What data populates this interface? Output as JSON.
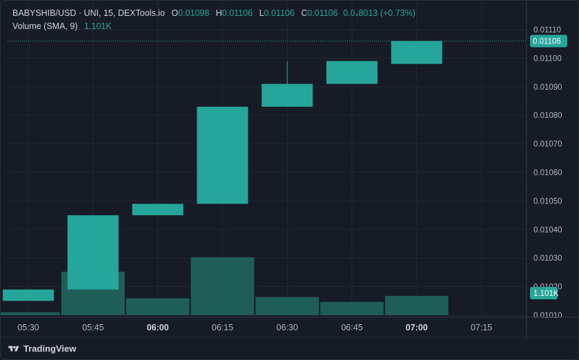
{
  "legend": {
    "symbol": "BABYSHIB/USD · UNI, 15, DEXTools.io",
    "o_label": "O",
    "o_value": "0.01098",
    "h_label": "H",
    "h_value": "0.01106",
    "l_label": "L",
    "l_value": "0.01106",
    "c_label": "C",
    "c_value": "0.01106",
    "change": "0.0₄8013 (+0.73%)",
    "volume_label": "Volume (SMA, 9)",
    "volume_value": "1.101K"
  },
  "brand": "TradingView",
  "colors": {
    "background": "#171b26",
    "grid": "#242833",
    "up": "#26a69a",
    "volume": "#1f5e58",
    "text": "#b2b5be"
  },
  "chart_data": {
    "type": "candlestick",
    "x_ticks": [
      {
        "label": "05:30",
        "bold": false
      },
      {
        "label": "05:45",
        "bold": false
      },
      {
        "label": "06:00",
        "bold": true
      },
      {
        "label": "06:15",
        "bold": false
      },
      {
        "label": "06:30",
        "bold": false
      },
      {
        "label": "06:45",
        "bold": false
      },
      {
        "label": "07:00",
        "bold": true
      },
      {
        "label": "07:15",
        "bold": false
      }
    ],
    "y_ticks": [
      "0.01110",
      "0.01100",
      "0.01090",
      "0.01080",
      "0.01070",
      "0.01060",
      "0.01050",
      "0.01040",
      "0.01030",
      "0.01020",
      "0.01010"
    ],
    "y_range": [
      0.0101,
      0.0111
    ],
    "last_price_label": "0.01106",
    "volume_label_tag": "1.101K",
    "candles": [
      {
        "time": "05:30",
        "open": 0.01015,
        "high": 0.01019,
        "low": 0.01015,
        "close": 0.01019,
        "volume": 0.12
      },
      {
        "time": "05:45",
        "open": 0.01019,
        "high": 0.01045,
        "low": 0.01019,
        "close": 0.01045,
        "volume": 1.8
      },
      {
        "time": "06:00",
        "open": 0.01045,
        "high": 0.01049,
        "low": 0.01045,
        "close": 0.01049,
        "volume": 0.7
      },
      {
        "time": "06:15",
        "open": 0.01049,
        "high": 0.01083,
        "low": 0.01049,
        "close": 0.01083,
        "volume": 2.4
      },
      {
        "time": "06:30",
        "open": 0.01083,
        "high": 0.01099,
        "low": 0.01083,
        "close": 0.01091,
        "volume": 0.75
      },
      {
        "time": "06:45",
        "open": 0.01091,
        "high": 0.01099,
        "low": 0.01091,
        "close": 0.01099,
        "volume": 0.55
      },
      {
        "time": "07:00",
        "open": 0.01098,
        "high": 0.01106,
        "low": 0.01098,
        "close": 0.01106,
        "volume": 0.8
      }
    ],
    "volume_max": 4.0,
    "grid": true
  }
}
